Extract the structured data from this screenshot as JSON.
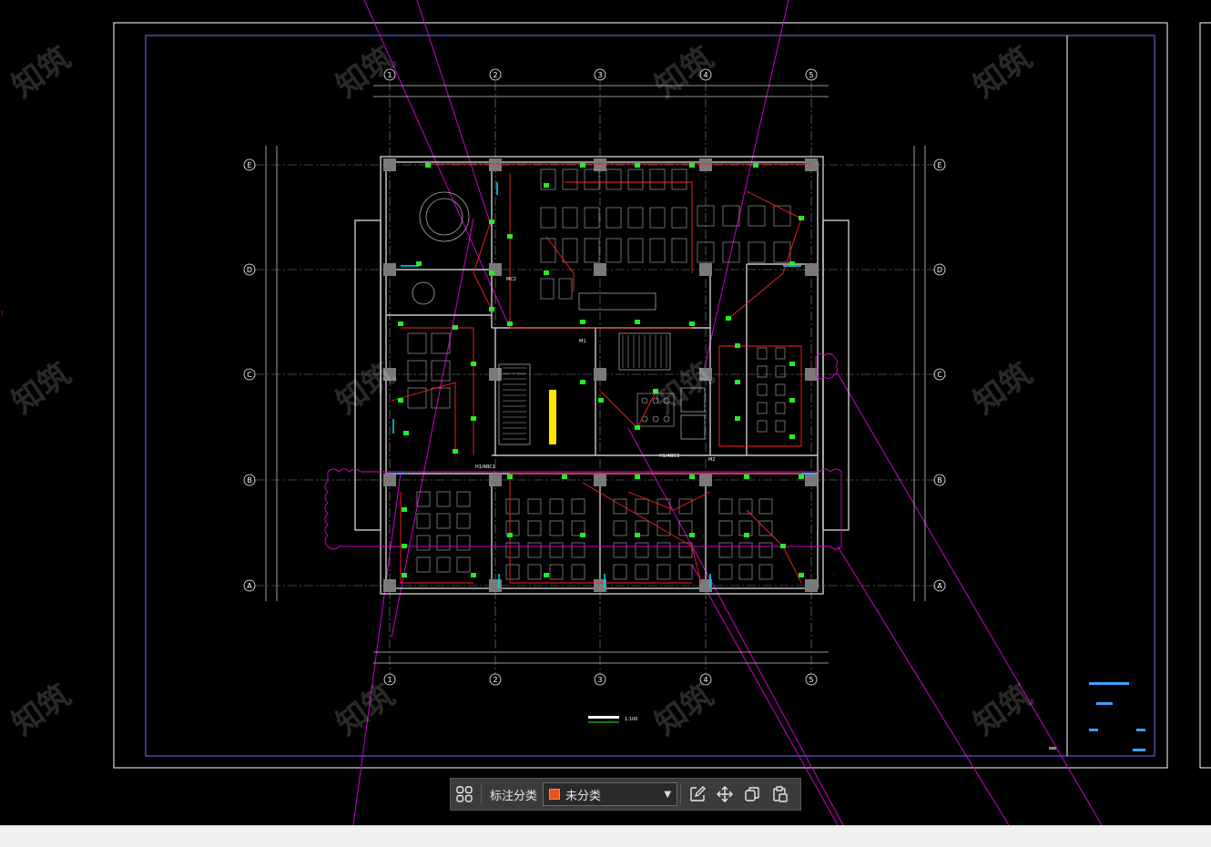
{
  "toolbar": {
    "category_label": "标注分类",
    "category_value": "未分类",
    "category_color": "#e8521e",
    "buttons": [
      "grid-icon",
      "edit-icon",
      "move-icon",
      "copy-icon",
      "paste-icon"
    ]
  },
  "drawing": {
    "background": "#000000",
    "axis_columns": [
      "1",
      "2",
      "3",
      "4",
      "5"
    ],
    "axis_rows": [
      "E",
      "D",
      "C",
      "B",
      "A"
    ],
    "labels": [
      "MC2",
      "M1",
      "M2",
      "H1/ABC1",
      "H1/ABC3",
      "1:100"
    ],
    "left_edge_text": "7",
    "watermark_text": "知筑",
    "colors": {
      "frame": "#ffffff",
      "inner_frame": "#6c72ff",
      "walls": "#c8c8c8",
      "red_lines": "#ff2020",
      "green_marks": "#22ee22",
      "magenta": "#d100d1",
      "cyan": "#00d7ff",
      "yellow": "#ffe600"
    }
  }
}
